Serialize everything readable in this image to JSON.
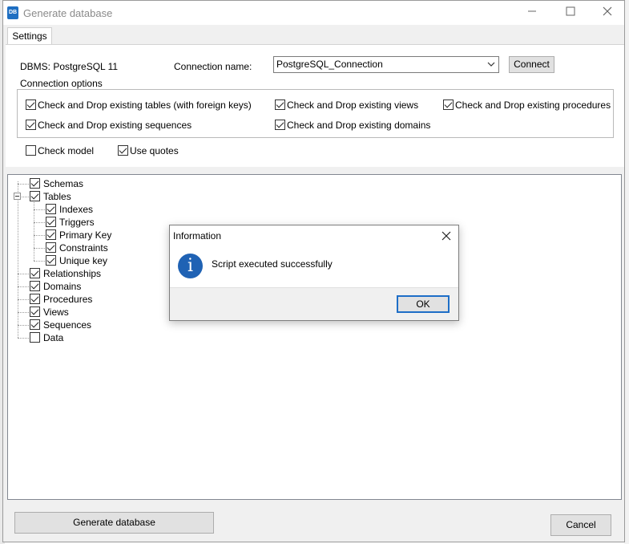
{
  "window": {
    "title": "Generate database",
    "app_icon_text": "DB"
  },
  "tabs": [
    {
      "label": "Settings"
    }
  ],
  "settings": {
    "dbms_label": "DBMS: PostgreSQL 11",
    "connection_name_label": "Connection name:",
    "connection_value": "PostgreSQL_Connection",
    "connect_label": "Connect",
    "connection_options_label": "Connection options",
    "options": [
      {
        "label": "Check and Drop existing tables (with foreign keys)",
        "checked": true
      },
      {
        "label": "Check and Drop existing views",
        "checked": true
      },
      {
        "label": "Check and Drop existing procedures",
        "checked": true
      },
      {
        "label": "Check and Drop existing sequences",
        "checked": true
      },
      {
        "label": "Check and Drop existing domains",
        "checked": true
      }
    ],
    "check_model": {
      "label": "Check model",
      "checked": false
    },
    "use_quotes": {
      "label": "Use quotes",
      "checked": true
    }
  },
  "tree": [
    {
      "label": "Schemas",
      "checked": true
    },
    {
      "label": "Tables",
      "checked": true,
      "expanded": true,
      "children": [
        {
          "label": "Indexes",
          "checked": true
        },
        {
          "label": "Triggers",
          "checked": true
        },
        {
          "label": "Primary Key",
          "checked": true
        },
        {
          "label": "Constraints",
          "checked": true
        },
        {
          "label": "Unique key",
          "checked": true
        }
      ]
    },
    {
      "label": "Relationships",
      "checked": true
    },
    {
      "label": "Domains",
      "checked": true
    },
    {
      "label": "Procedures",
      "checked": true
    },
    {
      "label": "Views",
      "checked": true
    },
    {
      "label": "Sequences",
      "checked": true
    },
    {
      "label": "Data",
      "checked": false
    }
  ],
  "footer": {
    "generate_label": "Generate database",
    "cancel_label": "Cancel"
  },
  "dialog": {
    "title": "Information",
    "message": "Script executed successfully",
    "ok_label": "OK",
    "icon": "info-icon",
    "icon_glyph": "i",
    "icon_color": "#1f62b4"
  }
}
